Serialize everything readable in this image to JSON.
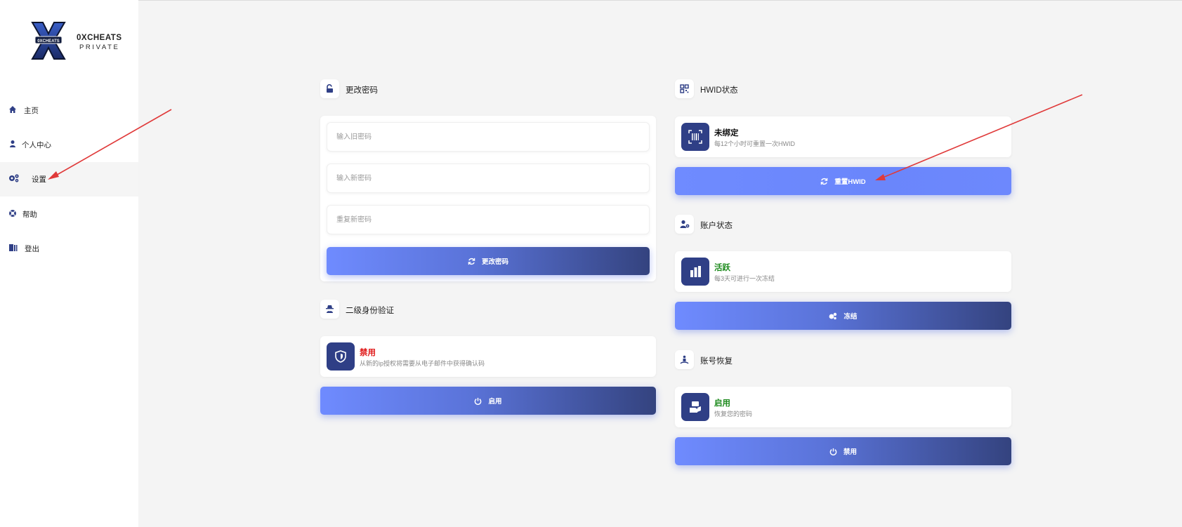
{
  "brand": {
    "name": "0XCHEATS",
    "sub": "PRIVATE",
    "logo_text": "0XCHEATS"
  },
  "sidebar": {
    "items": [
      {
        "label": "主页",
        "icon": "home-icon"
      },
      {
        "label": "个人中心",
        "icon": "user-icon"
      },
      {
        "label": "设置",
        "icon": "gears-icon",
        "active": true
      },
      {
        "label": "帮助",
        "icon": "life-ring-icon"
      },
      {
        "label": "登出",
        "icon": "door-icon"
      }
    ]
  },
  "password": {
    "title": "更改密码",
    "old_placeholder": "输入旧密码",
    "new_placeholder": "输入新密码",
    "repeat_placeholder": "重复新密码",
    "button": "更改密码"
  },
  "twofa": {
    "title": "二级身份验证",
    "status": "禁用",
    "desc": "从新的ip授权将需要从电子邮件中获得确认码",
    "button": "启用"
  },
  "hwid": {
    "title": "HWID状态",
    "status": "未绑定",
    "desc": "每12个小时可重置一次HWID",
    "button": "重置HWID"
  },
  "account": {
    "title": "账户状态",
    "status": "活跃",
    "desc": "每3天可进行一次冻结",
    "button": "冻结"
  },
  "recovery": {
    "title": "账号恢复",
    "status": "启用",
    "desc": "恢复您的密码",
    "button": "禁用"
  },
  "colors": {
    "accent_start": "#6f8bff",
    "accent_end": "#34437f",
    "icon_bg": "#2f3f86",
    "status_red": "#e01b1b",
    "status_green": "#1c8a1c",
    "annotation_arrow": "#e03a3a"
  }
}
